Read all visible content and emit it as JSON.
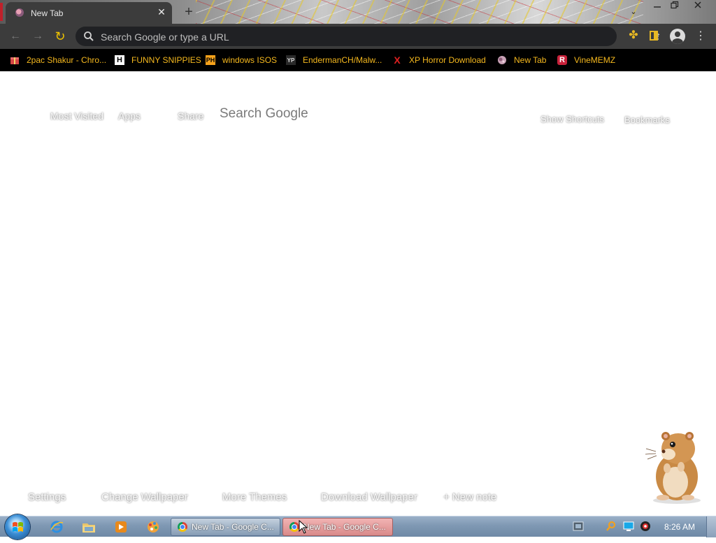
{
  "browser": {
    "tab": {
      "title": "New Tab",
      "close_symbol": "✕"
    },
    "new_tab_symbol": "+",
    "window_controls": {
      "chevron": "⌄",
      "minimize": "▭",
      "restore": "❐",
      "close": "✕"
    },
    "toolbar": {
      "back_symbol": "←",
      "forward_symbol": "→",
      "reload_symbol": "↻",
      "omnibox_placeholder": "Search Google or type a URL",
      "omnibox_value": "",
      "share_symbol": "⇪",
      "star_symbol": "★",
      "extensions_symbol": "✤",
      "menu_symbol": "⋮",
      "accent_color": "#f5b81e",
      "star_color": "#4f8ef7"
    },
    "bookmarks": [
      {
        "label": "2pac Shakur - Chro...",
        "icon": "gift-icon"
      },
      {
        "label": "FUNNY SNIPPIES",
        "icon": "h-logo-icon",
        "glyph": "H"
      },
      {
        "label": "windows ISOS",
        "icon": "ph-logo-icon",
        "glyph": "PH"
      },
      {
        "label": "EndermanCH/Malw...",
        "icon": "yp-logo-icon",
        "glyph": "YP"
      },
      {
        "label": "XP Horror Download",
        "icon": "x-logo-icon",
        "glyph": "X"
      },
      {
        "label": "New Tab",
        "icon": "globe-icon"
      },
      {
        "label": "VineMEMZ",
        "icon": "r-logo-icon",
        "glyph": "R"
      }
    ]
  },
  "newtab": {
    "top_left_links": {
      "most_visited": "Most Visited",
      "apps": "Apps",
      "share": "Share"
    },
    "search_label": "Search Google",
    "top_right_links": {
      "show_shortcuts": "Show Shortcuts",
      "bookmarks": "Bookmarks"
    },
    "bottom_links": {
      "settings": "Settings",
      "change_wallpaper": "Change Wallpaper",
      "more_themes": "More Themes",
      "download_wallpaper": "Download Wallpaper",
      "new_note": "+ New note"
    }
  },
  "taskbar": {
    "windows": [
      {
        "label": "New Tab - Google C...",
        "active": false
      },
      {
        "label": "New Tab - Google C...",
        "active": true
      }
    ],
    "pinned_icons": [
      "internet-explorer-icon",
      "file-explorer-icon",
      "media-player-icon",
      "paint-app-icon"
    ],
    "tray_icons": [
      "network-icon",
      "search-tray-icon",
      "display-icon",
      "volume-icon"
    ],
    "clock": "8:26 AM"
  }
}
